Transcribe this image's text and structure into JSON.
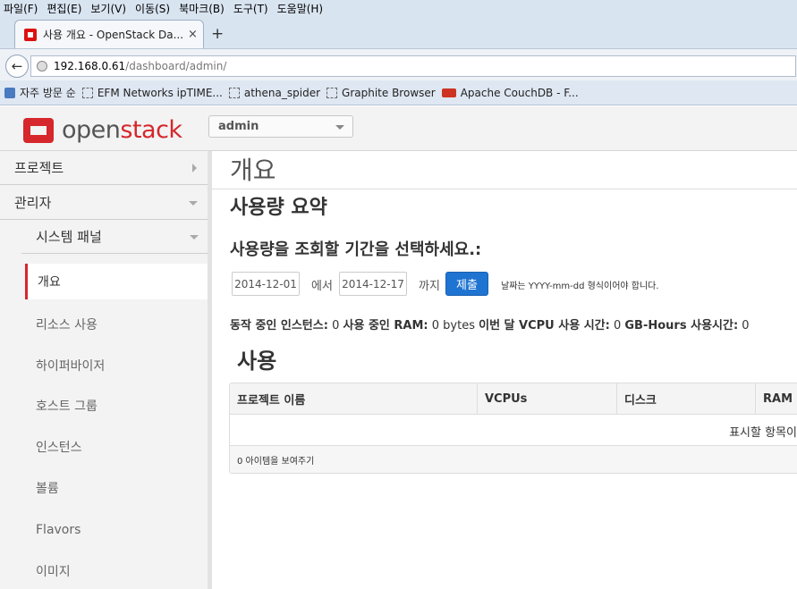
{
  "browser": {
    "menu": [
      "파일(F)",
      "편집(E)",
      "보기(V)",
      "이동(S)",
      "북마크(B)",
      "도구(T)",
      "도움말(H)"
    ],
    "tab_title": "사용 개요 - OpenStack Da...",
    "tab_close": "×",
    "new_tab": "+",
    "url_host": "192.168.0.61",
    "url_path": "/dashboard/admin/",
    "bookmarks": [
      "자주 방문 순",
      "EFM Networks ipTIME...",
      "athena_spider",
      "Graphite Browser",
      "Apache CouchDB - F..."
    ]
  },
  "header": {
    "logo_part1": "open",
    "logo_part2": "stack",
    "project": "admin"
  },
  "sidebar": {
    "project_label": "프로젝트",
    "admin_label": "관리자",
    "panel_label": "시스템 패널",
    "items": [
      "개요",
      "리소스 사용",
      "하이퍼바이저",
      "호스트 그룹",
      "인스턴스",
      "볼륨",
      "Flavors",
      "이미지"
    ]
  },
  "main": {
    "page_title": "개요",
    "summary_title": "사용량 요약",
    "period_label": "사용량을 조회할 기간을 선택하세요.:",
    "start_date": "2014-12-01",
    "from_label": "에서",
    "end_date": "2014-12-17",
    "to_label": "까지",
    "submit_label": "제출",
    "format_hint": "날짜는 YYYY-mm-dd 형식이어야 합니다.",
    "stats": {
      "instances_label": "동작 중인 인스턴스:",
      "instances_value": "0",
      "ram_label": "사용 중인 RAM:",
      "ram_value": "0 bytes",
      "vcpu_label": "이번 달 VCPU 사용 시간:",
      "vcpu_value": "0",
      "gb_label": "GB-Hours 사용시간:",
      "gb_value": "0"
    },
    "usage_title": "사용",
    "table": {
      "columns": [
        "프로젝트 이름",
        "VCPUs",
        "디스크",
        "RAM"
      ],
      "empty_text": "표시할 항목이",
      "footer": "0 아이템을 보여주기"
    }
  },
  "colors": {
    "brand_red": "#d5272c",
    "primary_blue": "#1f74d2"
  }
}
